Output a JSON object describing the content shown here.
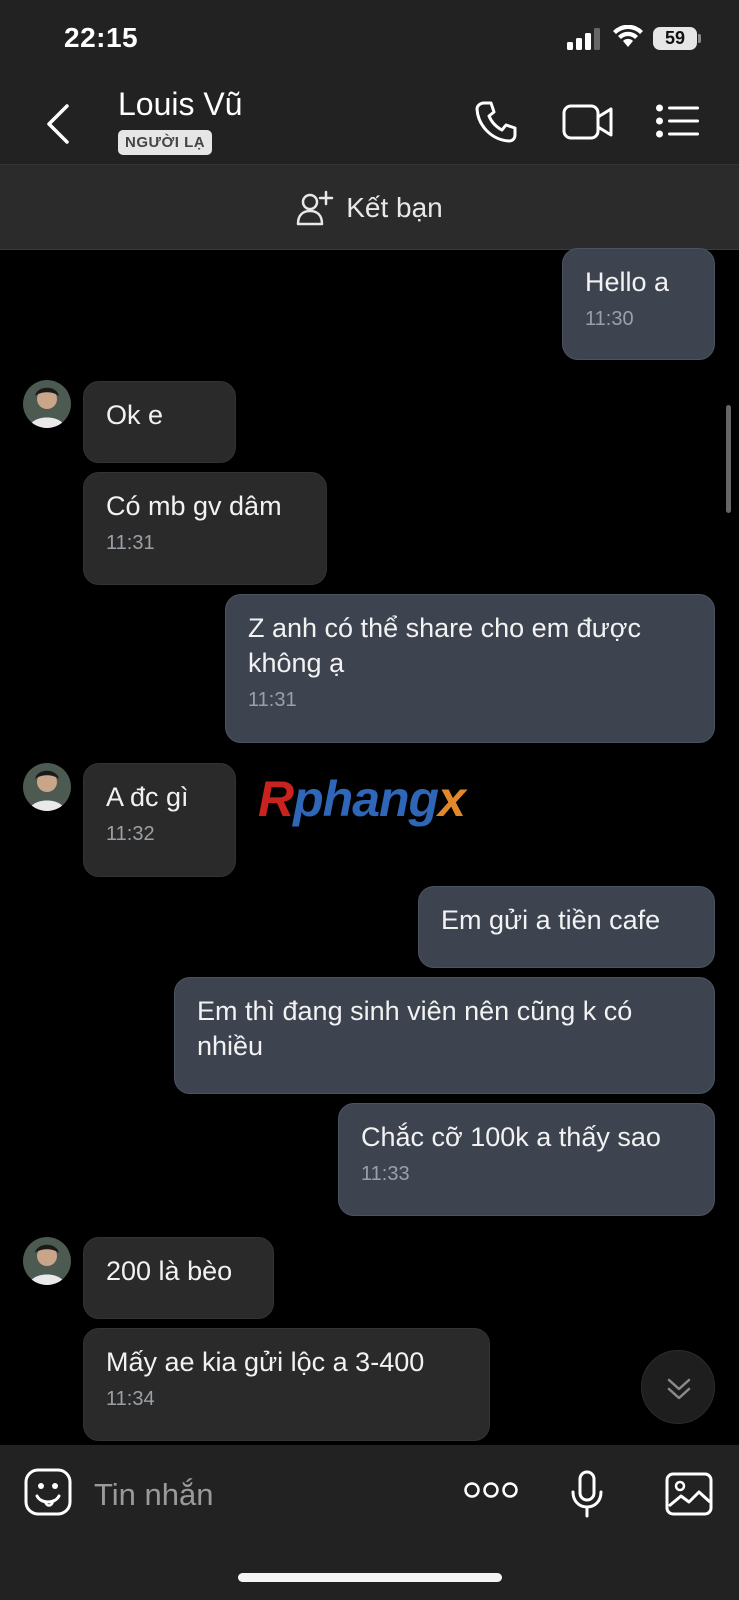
{
  "status_bar": {
    "time": "22:15",
    "battery": "59"
  },
  "header": {
    "name": "Louis Vũ",
    "badge": "NGƯỜI LẠ"
  },
  "add_friend": {
    "label": "Kết bạn"
  },
  "messages": [
    {
      "from": "me",
      "text": "Hello a",
      "time": "11:30"
    },
    {
      "from": "them",
      "text": "Ok e",
      "time": ""
    },
    {
      "from": "them",
      "text": "Có mb gv dâm",
      "time": "11:31"
    },
    {
      "from": "me",
      "text": "Z anh có thể share cho em được không ạ",
      "time": "11:31"
    },
    {
      "from": "them",
      "text": "A đc gì",
      "time": "11:32"
    },
    {
      "from": "me",
      "text": "Em gửi a tiền cafe",
      "time": ""
    },
    {
      "from": "me",
      "text": "Em thì đang sinh viên nên cũng k có nhiều",
      "time": ""
    },
    {
      "from": "me",
      "text": "Chắc cỡ 100k a thấy sao",
      "time": "11:33"
    },
    {
      "from": "them",
      "text": "200 là bèo",
      "time": ""
    },
    {
      "from": "them",
      "text": "Mấy ae kia gửi lộc a 3-400",
      "time": "11:34"
    }
  ],
  "watermark": {
    "part1": "R",
    "part2": "phang",
    "part3": "x"
  },
  "composer": {
    "placeholder": "Tin nhắn"
  },
  "icons": [
    "back-icon",
    "phone-icon",
    "video-call-icon",
    "list-menu-icon",
    "add-friend-icon",
    "sticker-icon",
    "more-icon",
    "microphone-icon",
    "image-icon",
    "chevron-down-icon"
  ]
}
